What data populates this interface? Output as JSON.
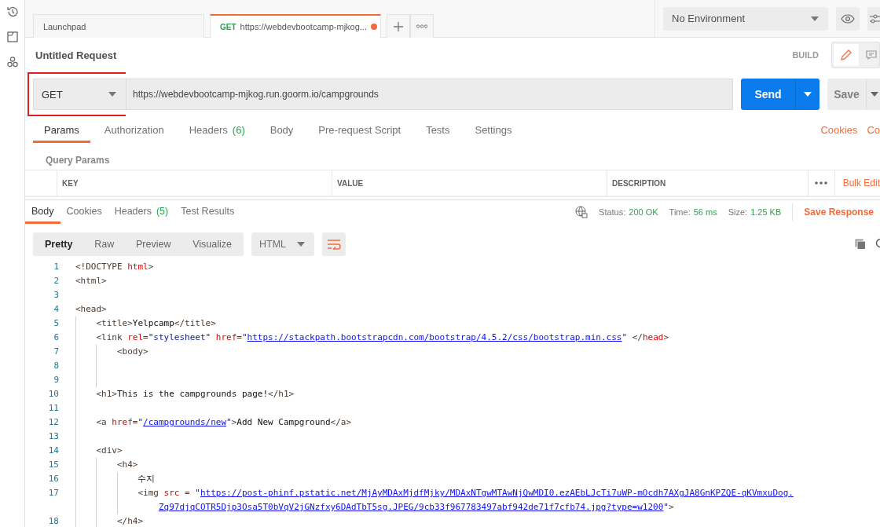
{
  "tabs": [
    {
      "label": "Launchpad",
      "selected": false,
      "unsaved": false
    },
    {
      "method": "GET",
      "label": "https://webdevbootcamp-mjkog...",
      "selected": true,
      "unsaved": true
    }
  ],
  "environment": {
    "value": "No Environment"
  },
  "request": {
    "title": "Untitled Request",
    "mode_label": "BUILD",
    "modes": [
      {
        "kind": "edit",
        "selected": true
      },
      {
        "kind": "comments",
        "selected": false
      }
    ],
    "method": "GET",
    "method_highlighted": true,
    "url": "https://webdevbootcamp-mjkog.run.goorm.io/campgrounds",
    "send": "Send",
    "save": "Save"
  },
  "request_tabs": [
    {
      "label": "Params",
      "selected": true
    },
    {
      "label": "Authorization",
      "selected": false
    },
    {
      "label": "Headers",
      "count": "(6)",
      "selected": false
    },
    {
      "label": "Body",
      "selected": false
    },
    {
      "label": "Pre-request Script",
      "selected": false
    },
    {
      "label": "Tests",
      "selected": false
    },
    {
      "label": "Settings",
      "selected": false
    }
  ],
  "request_links": [
    "Cookies",
    "Co"
  ],
  "query_params": {
    "title": "Query Params",
    "columns": [
      "KEY",
      "VALUE",
      "DESCRIPTION"
    ],
    "bulk_edit": "Bulk Edit"
  },
  "response_tabs": [
    {
      "label": "Body",
      "selected": true
    },
    {
      "label": "Cookies",
      "selected": false
    },
    {
      "label": "Headers",
      "count": "(5)",
      "selected": false
    },
    {
      "label": "Test Results",
      "selected": false
    }
  ],
  "response_meta": [
    {
      "label": "Status:",
      "value": "200 OK"
    },
    {
      "label": "Time:",
      "value": "56 ms"
    },
    {
      "label": "Size:",
      "value": "1.25 KB"
    }
  ],
  "save_response": "Save Response",
  "view_modes": [
    {
      "label": "Pretty",
      "selected": true
    },
    {
      "label": "Raw",
      "selected": false
    },
    {
      "label": "Preview",
      "selected": false
    },
    {
      "label": "Visualize",
      "selected": false
    }
  ],
  "format": "HTML",
  "code_lines": [
    {
      "number": "1",
      "tokens": [
        {
          "kind": "tag",
          "text": "<!DOCTYPE "
        },
        {
          "kind": "attr",
          "text": "html"
        },
        {
          "kind": "tag",
          "text": ">"
        }
      ]
    },
    {
      "number": "2",
      "tokens": [
        {
          "kind": "tag",
          "text": "<html>"
        }
      ]
    },
    {
      "number": "3"
    },
    {
      "number": "4",
      "tokens": [
        {
          "kind": "tag",
          "text": "<head>"
        }
      ]
    },
    {
      "number": "5",
      "tokens": [
        {
          "kind": "tag",
          "text": "    <title>"
        },
        {
          "kind": "text",
          "text": "Yelpcamp"
        },
        {
          "kind": "tag",
          "text": "</title>"
        }
      ]
    },
    {
      "number": "6",
      "tokens": [
        {
          "kind": "tag",
          "text": "    <link "
        },
        {
          "kind": "attr",
          "text": "rel"
        },
        {
          "kind": "tag",
          "text": "="
        },
        {
          "kind": "string",
          "text": "\"stylesheet\" "
        },
        {
          "kind": "attr",
          "text": "href"
        },
        {
          "kind": "tag",
          "text": "="
        },
        {
          "kind": "string",
          "text": "\""
        },
        {
          "kind": "link",
          "text": "https://stackpath.bootstrapcdn.com/bootstrap/4.5.2/css/bootstrap.min.css"
        },
        {
          "kind": "string",
          "text": "\""
        },
        {
          "kind": "tag",
          "text": " </"
        },
        {
          "kind": "attr",
          "text": "head"
        },
        {
          "kind": "tag",
          "text": ">"
        }
      ]
    },
    {
      "number": "7",
      "tokens": [
        {
          "kind": "tag",
          "text": "        <body>"
        }
      ]
    },
    {
      "number": "8"
    },
    {
      "number": "9"
    },
    {
      "number": "10",
      "tokens": [
        {
          "kind": "tag",
          "text": "    <h1>"
        },
        {
          "kind": "text",
          "text": "This is the campgrounds page!"
        },
        {
          "kind": "tag",
          "text": "</h1>"
        }
      ]
    },
    {
      "number": "11"
    },
    {
      "number": "12",
      "tokens": [
        {
          "kind": "tag",
          "text": "    <a "
        },
        {
          "kind": "attr",
          "text": "href"
        },
        {
          "kind": "tag",
          "text": "="
        },
        {
          "kind": "string",
          "text": "\""
        },
        {
          "kind": "link",
          "text": "/campgrounds/new"
        },
        {
          "kind": "string",
          "text": "\""
        },
        {
          "kind": "tag",
          "text": ">"
        },
        {
          "kind": "text",
          "text": "Add New Campground"
        },
        {
          "kind": "tag",
          "text": "</a>"
        }
      ]
    },
    {
      "number": "13"
    },
    {
      "number": "14",
      "tokens": [
        {
          "kind": "tag",
          "text": "    <div>"
        }
      ]
    },
    {
      "number": "15",
      "tokens": [
        {
          "kind": "tag",
          "text": "        <h4>"
        }
      ]
    },
    {
      "number": "16",
      "tokens": [
        {
          "kind": "text",
          "text": "            수지"
        }
      ]
    },
    {
      "number": "17",
      "tokens": [
        {
          "kind": "tag",
          "text": "            <img "
        },
        {
          "kind": "attr",
          "text": "src"
        },
        {
          "kind": "tag",
          "text": " = "
        },
        {
          "kind": "string",
          "text": "\""
        },
        {
          "kind": "link",
          "text": "https://post-phinf.pstatic.net/MjAyMDAxMjdfMjky/MDAxNTgwMTAwNjQwMDI0.ezAEbLJcTi7uWP-mOcdh7AXgJA8GnKPZQE-qKVmxuDog."
        }
      ]
    },
    {
      "tokens": [
        {
          "kind": "link",
          "text": "                Zq97djqCOTR5Djp3Osa5T0bVqV2jGNzfxy6DAdTbT5sg.JPEG/9cb33f967783497abf942de71f7cfb74.jpg?type=w1200"
        },
        {
          "kind": "string",
          "text": "\""
        },
        {
          "kind": "tag",
          "text": ">"
        }
      ]
    },
    {
      "number": "18",
      "tokens": [
        {
          "kind": "tag",
          "text": "        </h4>"
        }
      ]
    }
  ]
}
